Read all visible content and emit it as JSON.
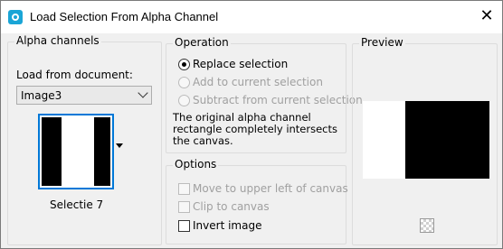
{
  "window": {
    "title": "Load Selection From Alpha Channel",
    "close_glyph": "✕"
  },
  "alpha_channels": {
    "group_label": "Alpha channels",
    "load_label": "Load from document:",
    "document_value": "Image3",
    "thumbnail_caption": "Selectie 7"
  },
  "operation": {
    "group_label": "Operation",
    "options": [
      {
        "label": "Replace selection",
        "checked": true,
        "enabled": true
      },
      {
        "label": "Add to current selection",
        "checked": false,
        "enabled": false
      },
      {
        "label": "Subtract from current selection",
        "checked": false,
        "enabled": false
      }
    ],
    "description": "The original alpha channel rectangle completely intersects the canvas."
  },
  "options": {
    "group_label": "Options",
    "items": [
      {
        "label": "Move to upper left of canvas",
        "checked": false,
        "enabled": false
      },
      {
        "label": "Clip to canvas",
        "checked": false,
        "enabled": false
      },
      {
        "label": "Invert image",
        "checked": false,
        "enabled": true
      }
    ]
  },
  "preview": {
    "group_label": "Preview",
    "icon": "checkerboard-icon"
  },
  "colors": {
    "accent": "#0078d7",
    "title_icon": "#1aa5d6"
  }
}
